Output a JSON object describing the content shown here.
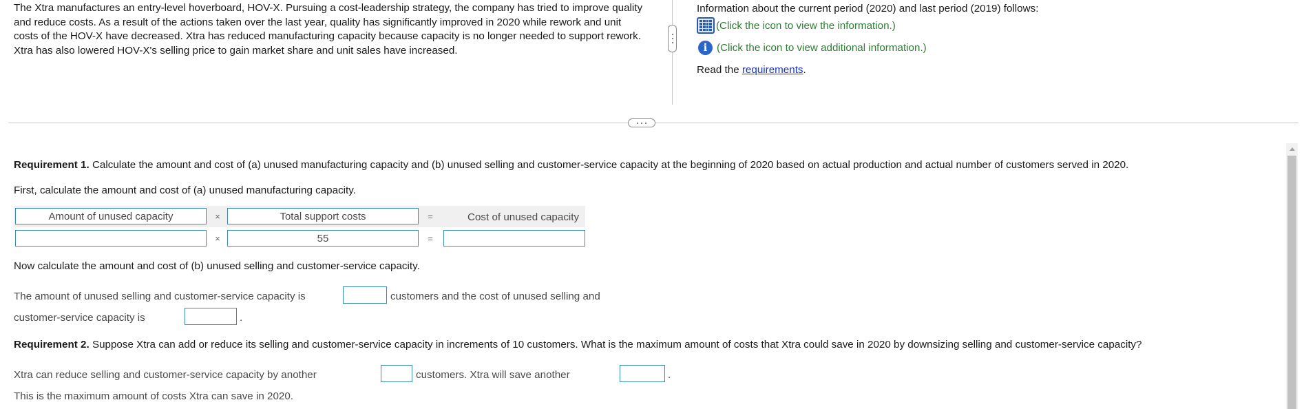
{
  "scenario": {
    "text": "The Xtra manufactures an entry-level hoverboard, HOV-X. Pursuing a cost-leadership strategy, the company has tried to improve quality and reduce costs. As a result of the actions taken over the last year, quality has significantly improved in 2020 while rework and unit costs of the HOV-X have decreased. Xtra has reduced manufacturing capacity because capacity is no longer needed to support rework. Xtra has also lowered HOV-X's selling price to gain market share and unit sales have increased."
  },
  "info": {
    "intro": "Information about the current period (2020) and last period (2019) follows:",
    "view_info_link": "(Click the icon to view the information.)",
    "additional_info_link": "(Click the icon to view additional information.)",
    "read_prefix": "Read the ",
    "requirements_link": "requirements",
    "read_suffix": "."
  },
  "requirement1": {
    "label": "Requirement 1.",
    "text": " Calculate the amount and cost of (a) unused manufacturing capacity and (b) unused selling and customer-service capacity at the beginning of 2020 based on actual production and actual number of customers served in 2020.",
    "first_line": "First, calculate the amount and cost of (a) unused manufacturing capacity.",
    "calc": {
      "header_amount": "Amount of unused capacity",
      "header_support": "Total support costs",
      "header_cost": "Cost of unused capacity",
      "op_times": "×",
      "op_equals": "=",
      "support_value": "55",
      "amount_value": "",
      "cost_value": ""
    },
    "second_line": "Now calculate the amount and cost of (b) unused selling and customer-service capacity.",
    "selling_sentence_a": "The amount of unused selling and customer-service capacity is",
    "selling_sentence_b": "customers and the cost of unused selling and",
    "selling_sentence_c": "customer-service capacity is",
    "selling_sentence_end": "."
  },
  "requirement2": {
    "label": "Requirement 2.",
    "text": " Suppose Xtra can add or reduce its selling and customer-service capacity in increments of 10 customers. What is the maximum amount of costs that Xtra could save in 2020 by downsizing selling and customer-service capacity?",
    "sentence_a": "Xtra can reduce selling and customer-service capacity by another",
    "sentence_b": "customers. Xtra will save another",
    "sentence_end": ".",
    "last_line": "This is the maximum amount of costs Xtra can save in 2020."
  },
  "colors": {
    "link_green": "#2e7d32",
    "link_blue": "#1a33c9",
    "input_border": "#3a8ab8"
  },
  "icons": [
    "table-icon",
    "info-icon",
    "vertical-split-handle-icon",
    "horizontal-split-handle-icon",
    "scroll-up-arrow-icon"
  ]
}
